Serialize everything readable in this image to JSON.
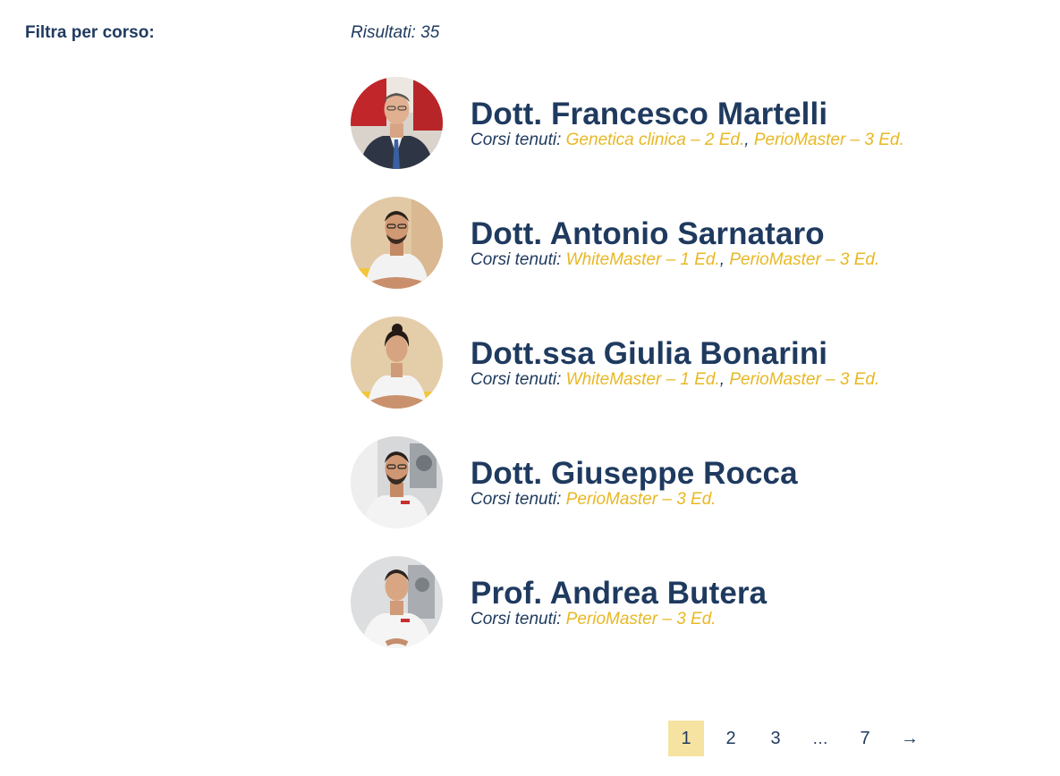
{
  "filter": {
    "label": "Filtra per corso:"
  },
  "results": {
    "label": "Risultati:",
    "count": "35"
  },
  "courses_prefix": "Corsi tenuti:",
  "doctors": [
    {
      "name": "Dott. Francesco Martelli",
      "courses": [
        "Genetica clinica – 2 Ed.",
        "PerioMaster – 3 Ed."
      ]
    },
    {
      "name": "Dott. Antonio Sarnataro",
      "courses": [
        "WhiteMaster – 1 Ed.",
        "PerioMaster – 3 Ed."
      ]
    },
    {
      "name": "Dott.ssa Giulia Bonarini",
      "courses": [
        "WhiteMaster – 1 Ed.",
        "PerioMaster – 3 Ed."
      ]
    },
    {
      "name": "Dott. Giuseppe Rocca",
      "courses": [
        "PerioMaster – 3 Ed."
      ]
    },
    {
      "name": "Prof. Andrea Butera",
      "courses": [
        "PerioMaster – 3 Ed."
      ]
    }
  ],
  "pagination": {
    "pages": [
      "1",
      "2",
      "3",
      "…",
      "7"
    ],
    "current": "1",
    "next": "→"
  },
  "colors": {
    "primary": "#1f3a5f",
    "accent": "#e8b825",
    "active_page_bg": "#f7e3a1"
  }
}
